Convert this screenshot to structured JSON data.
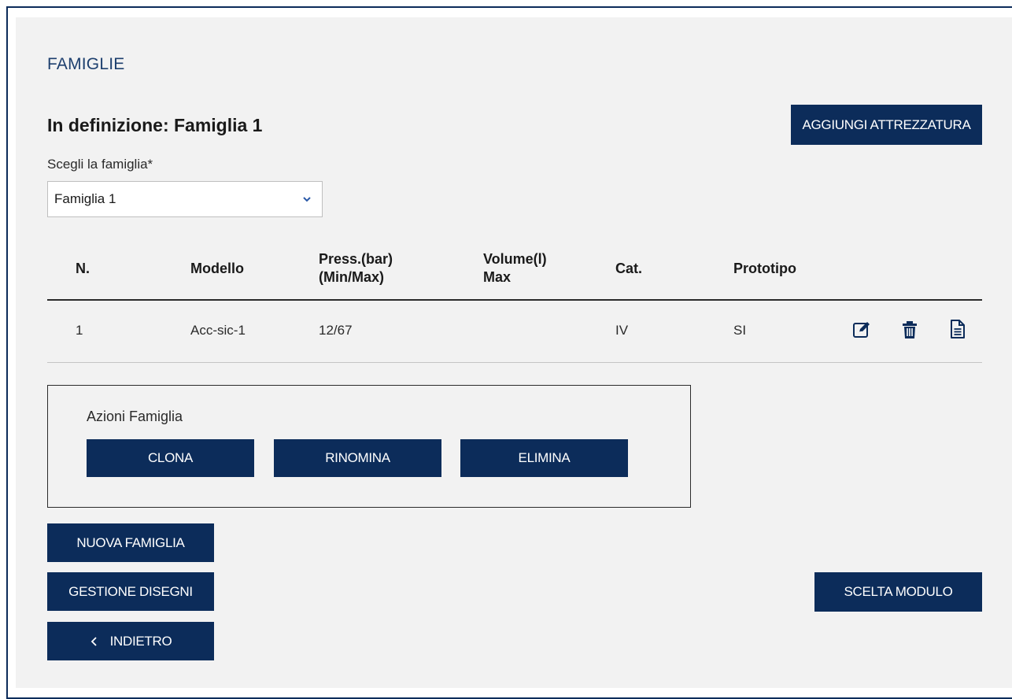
{
  "section": {
    "title": "FAMIGLIE"
  },
  "header": {
    "title": "In definizione: Famiglia 1",
    "add_button": "AGGIUNGI ATTREZZATURA"
  },
  "family_select": {
    "label": "Scegli la famiglia*",
    "value": "Famiglia 1"
  },
  "table": {
    "columns": {
      "n": "N.",
      "model": "Modello",
      "press_1": "Press.(bar)",
      "press_2": "(Min/Max)",
      "vol_1": "Volume(l)",
      "vol_2": "Max",
      "cat": "Cat.",
      "proto": "Prototipo"
    },
    "rows": [
      {
        "n": "1",
        "model": "Acc-sic-1",
        "press": "12/67",
        "volume": "",
        "cat": "IV",
        "proto": "SI",
        "icons": [
          "edit-icon",
          "trash-icon",
          "document-icon"
        ]
      }
    ]
  },
  "family_actions": {
    "label": "Azioni Famiglia",
    "clone": "CLONA",
    "rename": "RINOMINA",
    "delete": "ELIMINA"
  },
  "footer": {
    "new_family": "NUOVA FAMIGLIA",
    "drawings": "GESTIONE DISEGNI",
    "back": "INDIETRO",
    "back_icon": "chevron-left-icon",
    "module": "SCELTA MODULO"
  },
  "colors": {
    "button_bg": "#0c2c5a",
    "panel_bg": "#f2f2f2",
    "section_title": "#1d3f6e"
  }
}
